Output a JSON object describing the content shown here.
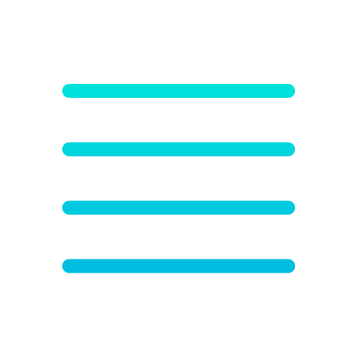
{
  "icon": {
    "name": "hamburger-menu-icon",
    "line_count": 4,
    "gradient": {
      "top_color": "#00E2D9",
      "bottom_color": "#00BCE2"
    },
    "background": "#FFFFFF"
  }
}
